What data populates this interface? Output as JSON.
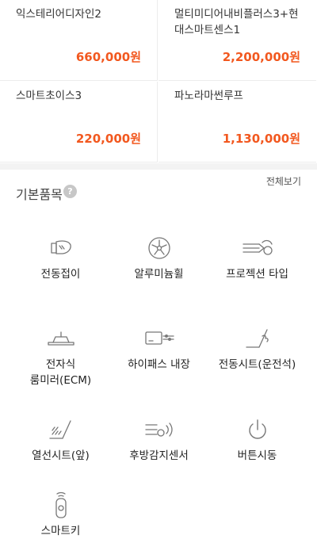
{
  "options": [
    {
      "name": "익스테리어디자인2",
      "price": "660,000원"
    },
    {
      "name": "멀티미디어내비플러스3+현대스마트센스1",
      "price": "2,200,000원"
    },
    {
      "name": "스마트초이스3",
      "price": "220,000원"
    },
    {
      "name": "파노라마썬루프",
      "price": "1,130,000원"
    }
  ],
  "basic": {
    "title": "기본품목",
    "help_icon": "?",
    "view_all": "전체보기",
    "items": [
      {
        "label": "전동접이",
        "icon": "folding-mirror-icon"
      },
      {
        "label": "알루미늄휠",
        "icon": "alloy-wheel-icon"
      },
      {
        "label": "프로젝션 타입",
        "icon": "projection-headlamp-icon"
      },
      {
        "label": "전자식\n룸미러(ECM)",
        "icon": "room-mirror-icon"
      },
      {
        "label": "하이패스 내장",
        "icon": "hipass-icon"
      },
      {
        "label": "전동시트(운전석)",
        "icon": "power-seat-icon"
      },
      {
        "label": "열선시트(앞)",
        "icon": "heated-seat-icon"
      },
      {
        "label": "후방감지센서",
        "icon": "rear-sensor-icon"
      },
      {
        "label": "버튼시동",
        "icon": "power-button-icon"
      },
      {
        "label": "스마트키",
        "icon": "smart-key-icon"
      }
    ]
  },
  "colors": {
    "price": "#f2581f",
    "icon": "#777777"
  }
}
